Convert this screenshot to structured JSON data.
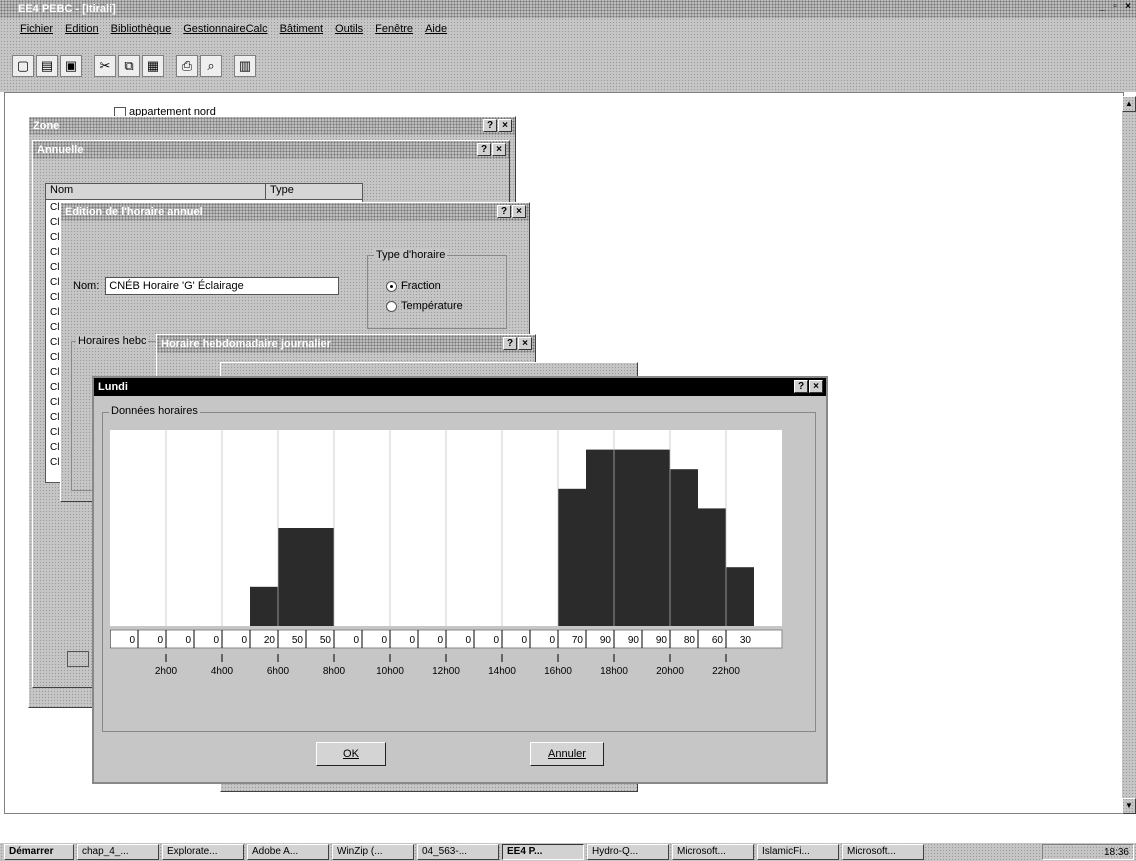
{
  "app": {
    "title": "EE4 PEBC - [Itirali]",
    "window_buttons": [
      "_",
      "▫",
      "×"
    ]
  },
  "menu": [
    "Fichier",
    "Edition",
    "Bibliothèque",
    "GestionnaireCalc",
    "Bâtiment",
    "Outils",
    "Fenêtre",
    "Aide"
  ],
  "toolbar_icons": [
    "new-icon",
    "open-icon",
    "save-icon",
    "cut-icon",
    "copy-icon",
    "paste-icon",
    "print-icon",
    "print-preview-icon",
    "calculator-icon"
  ],
  "tree": {
    "node_label": "appartement nord"
  },
  "zone_window": {
    "title": "Zone"
  },
  "annuelle_window": {
    "title": "Annuelle",
    "list_headers": [
      "Nom",
      "Type"
    ],
    "row_prefix": "Cl"
  },
  "edition_window": {
    "title": "Edition de l'horaire annuel",
    "nom_label": "Nom:",
    "nom_value": "CNÉB Horaire 'G' Éclairage",
    "type_group_label": "Type d'horaire",
    "type_options": [
      "Fraction",
      "Température"
    ],
    "type_selected": "Fraction",
    "horaires_label": "Horaires hebc"
  },
  "hebdo_window": {
    "title": "Horaire hebdomadaire journalier"
  },
  "lundi_window": {
    "title": "Lundi",
    "group_label": "Données horaires",
    "ok_label": "OK",
    "cancel_label": "Annuler",
    "close_buttons": [
      "?",
      "×"
    ]
  },
  "chart_data": {
    "type": "bar",
    "hours": [
      1,
      2,
      3,
      4,
      5,
      6,
      7,
      8,
      9,
      10,
      11,
      12,
      13,
      14,
      15,
      16,
      17,
      18,
      19,
      20,
      21,
      22,
      23,
      24
    ],
    "values": [
      0,
      0,
      0,
      0,
      0,
      20,
      50,
      50,
      0,
      0,
      0,
      0,
      0,
      0,
      0,
      0,
      70,
      90,
      90,
      90,
      80,
      60,
      30,
      0
    ],
    "value_labels": [
      "0",
      "0",
      "0",
      "0",
      "0",
      "20",
      "50",
      "50",
      "0",
      "0",
      "0",
      "0",
      "0",
      "0",
      "0",
      "0",
      "70",
      "90",
      "90",
      "90",
      "80",
      "60",
      "30"
    ],
    "tick_labels": [
      "2h00",
      "4h00",
      "6h00",
      "8h00",
      "10h00",
      "12h00",
      "14h00",
      "16h00",
      "18h00",
      "20h00",
      "22h00"
    ],
    "ylim": [
      0,
      100
    ],
    "bar_color": "#2b2b2b"
  },
  "taskbar": {
    "start": "Démarrer",
    "tasks": [
      "chap_4_...",
      "Explorate...",
      "Adobe A...",
      "WinZip (...",
      "04_563-...",
      "EE4 P...",
      "Hydro-Q...",
      "Microsoft...",
      "IslamicFi...",
      "Microsoft..."
    ],
    "active_task": "EE4 P...",
    "clock": "18:36"
  }
}
